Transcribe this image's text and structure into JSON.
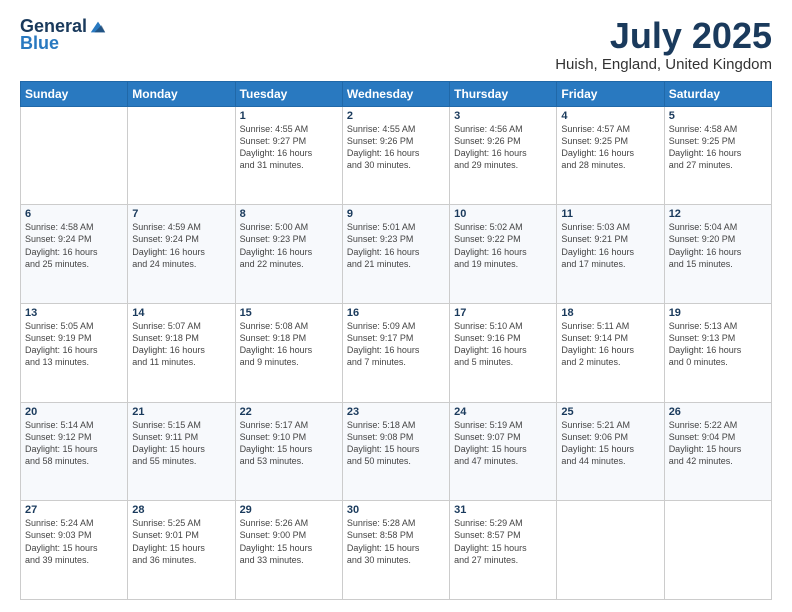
{
  "header": {
    "logo_general": "General",
    "logo_blue": "Blue",
    "main_title": "July 2025",
    "subtitle": "Huish, England, United Kingdom"
  },
  "weekdays": [
    "Sunday",
    "Monday",
    "Tuesday",
    "Wednesday",
    "Thursday",
    "Friday",
    "Saturday"
  ],
  "weeks": [
    [
      {
        "day": "",
        "detail": ""
      },
      {
        "day": "",
        "detail": ""
      },
      {
        "day": "1",
        "detail": "Sunrise: 4:55 AM\nSunset: 9:27 PM\nDaylight: 16 hours\nand 31 minutes."
      },
      {
        "day": "2",
        "detail": "Sunrise: 4:55 AM\nSunset: 9:26 PM\nDaylight: 16 hours\nand 30 minutes."
      },
      {
        "day": "3",
        "detail": "Sunrise: 4:56 AM\nSunset: 9:26 PM\nDaylight: 16 hours\nand 29 minutes."
      },
      {
        "day": "4",
        "detail": "Sunrise: 4:57 AM\nSunset: 9:25 PM\nDaylight: 16 hours\nand 28 minutes."
      },
      {
        "day": "5",
        "detail": "Sunrise: 4:58 AM\nSunset: 9:25 PM\nDaylight: 16 hours\nand 27 minutes."
      }
    ],
    [
      {
        "day": "6",
        "detail": "Sunrise: 4:58 AM\nSunset: 9:24 PM\nDaylight: 16 hours\nand 25 minutes."
      },
      {
        "day": "7",
        "detail": "Sunrise: 4:59 AM\nSunset: 9:24 PM\nDaylight: 16 hours\nand 24 minutes."
      },
      {
        "day": "8",
        "detail": "Sunrise: 5:00 AM\nSunset: 9:23 PM\nDaylight: 16 hours\nand 22 minutes."
      },
      {
        "day": "9",
        "detail": "Sunrise: 5:01 AM\nSunset: 9:23 PM\nDaylight: 16 hours\nand 21 minutes."
      },
      {
        "day": "10",
        "detail": "Sunrise: 5:02 AM\nSunset: 9:22 PM\nDaylight: 16 hours\nand 19 minutes."
      },
      {
        "day": "11",
        "detail": "Sunrise: 5:03 AM\nSunset: 9:21 PM\nDaylight: 16 hours\nand 17 minutes."
      },
      {
        "day": "12",
        "detail": "Sunrise: 5:04 AM\nSunset: 9:20 PM\nDaylight: 16 hours\nand 15 minutes."
      }
    ],
    [
      {
        "day": "13",
        "detail": "Sunrise: 5:05 AM\nSunset: 9:19 PM\nDaylight: 16 hours\nand 13 minutes."
      },
      {
        "day": "14",
        "detail": "Sunrise: 5:07 AM\nSunset: 9:18 PM\nDaylight: 16 hours\nand 11 minutes."
      },
      {
        "day": "15",
        "detail": "Sunrise: 5:08 AM\nSunset: 9:18 PM\nDaylight: 16 hours\nand 9 minutes."
      },
      {
        "day": "16",
        "detail": "Sunrise: 5:09 AM\nSunset: 9:17 PM\nDaylight: 16 hours\nand 7 minutes."
      },
      {
        "day": "17",
        "detail": "Sunrise: 5:10 AM\nSunset: 9:16 PM\nDaylight: 16 hours\nand 5 minutes."
      },
      {
        "day": "18",
        "detail": "Sunrise: 5:11 AM\nSunset: 9:14 PM\nDaylight: 16 hours\nand 2 minutes."
      },
      {
        "day": "19",
        "detail": "Sunrise: 5:13 AM\nSunset: 9:13 PM\nDaylight: 16 hours\nand 0 minutes."
      }
    ],
    [
      {
        "day": "20",
        "detail": "Sunrise: 5:14 AM\nSunset: 9:12 PM\nDaylight: 15 hours\nand 58 minutes."
      },
      {
        "day": "21",
        "detail": "Sunrise: 5:15 AM\nSunset: 9:11 PM\nDaylight: 15 hours\nand 55 minutes."
      },
      {
        "day": "22",
        "detail": "Sunrise: 5:17 AM\nSunset: 9:10 PM\nDaylight: 15 hours\nand 53 minutes."
      },
      {
        "day": "23",
        "detail": "Sunrise: 5:18 AM\nSunset: 9:08 PM\nDaylight: 15 hours\nand 50 minutes."
      },
      {
        "day": "24",
        "detail": "Sunrise: 5:19 AM\nSunset: 9:07 PM\nDaylight: 15 hours\nand 47 minutes."
      },
      {
        "day": "25",
        "detail": "Sunrise: 5:21 AM\nSunset: 9:06 PM\nDaylight: 15 hours\nand 44 minutes."
      },
      {
        "day": "26",
        "detail": "Sunrise: 5:22 AM\nSunset: 9:04 PM\nDaylight: 15 hours\nand 42 minutes."
      }
    ],
    [
      {
        "day": "27",
        "detail": "Sunrise: 5:24 AM\nSunset: 9:03 PM\nDaylight: 15 hours\nand 39 minutes."
      },
      {
        "day": "28",
        "detail": "Sunrise: 5:25 AM\nSunset: 9:01 PM\nDaylight: 15 hours\nand 36 minutes."
      },
      {
        "day": "29",
        "detail": "Sunrise: 5:26 AM\nSunset: 9:00 PM\nDaylight: 15 hours\nand 33 minutes."
      },
      {
        "day": "30",
        "detail": "Sunrise: 5:28 AM\nSunset: 8:58 PM\nDaylight: 15 hours\nand 30 minutes."
      },
      {
        "day": "31",
        "detail": "Sunrise: 5:29 AM\nSunset: 8:57 PM\nDaylight: 15 hours\nand 27 minutes."
      },
      {
        "day": "",
        "detail": ""
      },
      {
        "day": "",
        "detail": ""
      }
    ]
  ]
}
